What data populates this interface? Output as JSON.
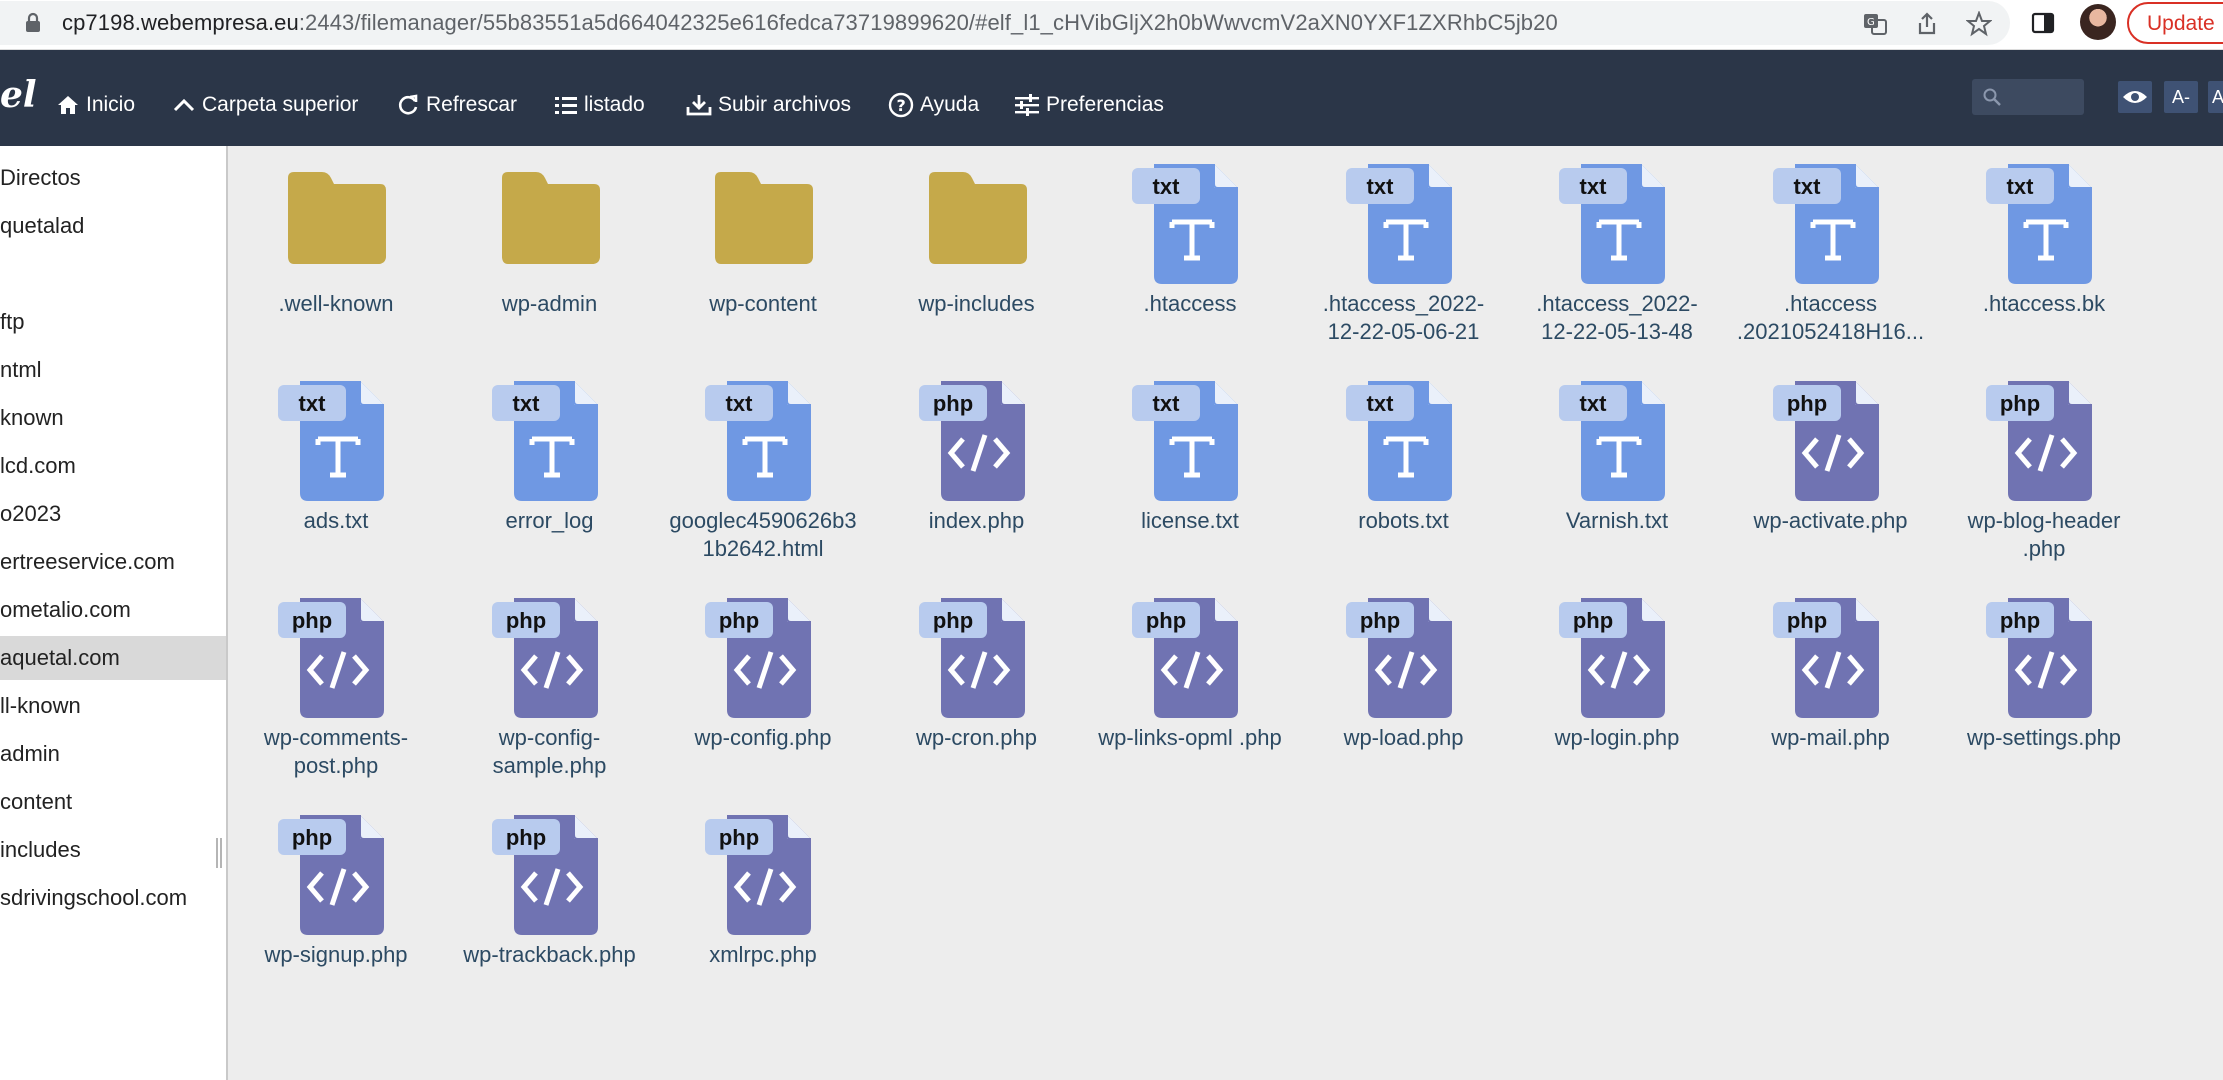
{
  "browser": {
    "url_host": "cp7198.webempresa.eu",
    "url_rest": ":2443/filemanager/55b83551a5d664042325e616fedca73719899620/#elf_l1_cHVibGljX2h0bWwvcmV2aXN0YXF1ZXRhbC5jb20",
    "update_label": "Update"
  },
  "toolbar": {
    "logo": "el",
    "buttons": [
      {
        "label": "Inicio",
        "icon": "home-icon"
      },
      {
        "label": "Carpeta superior",
        "icon": "chevron-up-icon"
      },
      {
        "label": "Refrescar",
        "icon": "refresh-icon"
      },
      {
        "label": "listado",
        "icon": "list-icon"
      },
      {
        "label": "Subir archivos",
        "icon": "upload-icon"
      },
      {
        "label": "Ayuda",
        "icon": "help-icon"
      },
      {
        "label": "Preferencias",
        "icon": "sliders-icon"
      }
    ],
    "font_smaller": "A-",
    "font_larger": "A"
  },
  "sidebar": {
    "items": [
      "Directos",
      "quetalad",
      "",
      "ftp",
      "ntml",
      "known",
      "lcd.com",
      "o2023",
      "ertreeservice.com",
      "ometalio.com",
      "aquetal.com",
      "ll-known",
      "admin",
      "content",
      "includes",
      "sdrivingschool.com"
    ],
    "selected_index": 10
  },
  "files": [
    {
      "name": ".well-known",
      "type": "folder"
    },
    {
      "name": "wp-admin",
      "type": "folder"
    },
    {
      "name": "wp-content",
      "type": "folder"
    },
    {
      "name": "wp-includes",
      "type": "folder"
    },
    {
      "name": ".htaccess",
      "type": "txt"
    },
    {
      "name": ".htaccess_2022-12-22-05-06-21",
      "type": "txt"
    },
    {
      "name": ".htaccess_2022-12-22-05-13-48",
      "type": "txt"
    },
    {
      "name": ".htaccess .2021052418H16...",
      "type": "txt"
    },
    {
      "name": ".htaccess.bk",
      "type": "txt"
    },
    {
      "name": "ads.txt",
      "type": "txt"
    },
    {
      "name": "error_log",
      "type": "txt"
    },
    {
      "name": "googlec4590626b31b2642.html",
      "type": "txt"
    },
    {
      "name": "index.php",
      "type": "php"
    },
    {
      "name": "license.txt",
      "type": "txt"
    },
    {
      "name": "robots.txt",
      "type": "txt"
    },
    {
      "name": "Varnish.txt",
      "type": "txt"
    },
    {
      "name": "wp-activate.php",
      "type": "php"
    },
    {
      "name": "wp-blog-header .php",
      "type": "php"
    },
    {
      "name": "wp-comments-post.php",
      "type": "php"
    },
    {
      "name": "wp-config-sample.php",
      "type": "php"
    },
    {
      "name": "wp-config.php",
      "type": "php"
    },
    {
      "name": "wp-cron.php",
      "type": "php"
    },
    {
      "name": "wp-links-opml .php",
      "type": "php"
    },
    {
      "name": "wp-load.php",
      "type": "php"
    },
    {
      "name": "wp-login.php",
      "type": "php"
    },
    {
      "name": "wp-mail.php",
      "type": "php"
    },
    {
      "name": "wp-settings.php",
      "type": "php"
    },
    {
      "name": "wp-signup.php",
      "type": "php"
    },
    {
      "name": "wp-trackback.php",
      "type": "php"
    },
    {
      "name": "xmlrpc.php",
      "type": "php"
    }
  ],
  "colors": {
    "folder": "#c5a94a",
    "txt": "#6f98e3",
    "php": "#7073b2",
    "badge": "#b8cbee"
  }
}
